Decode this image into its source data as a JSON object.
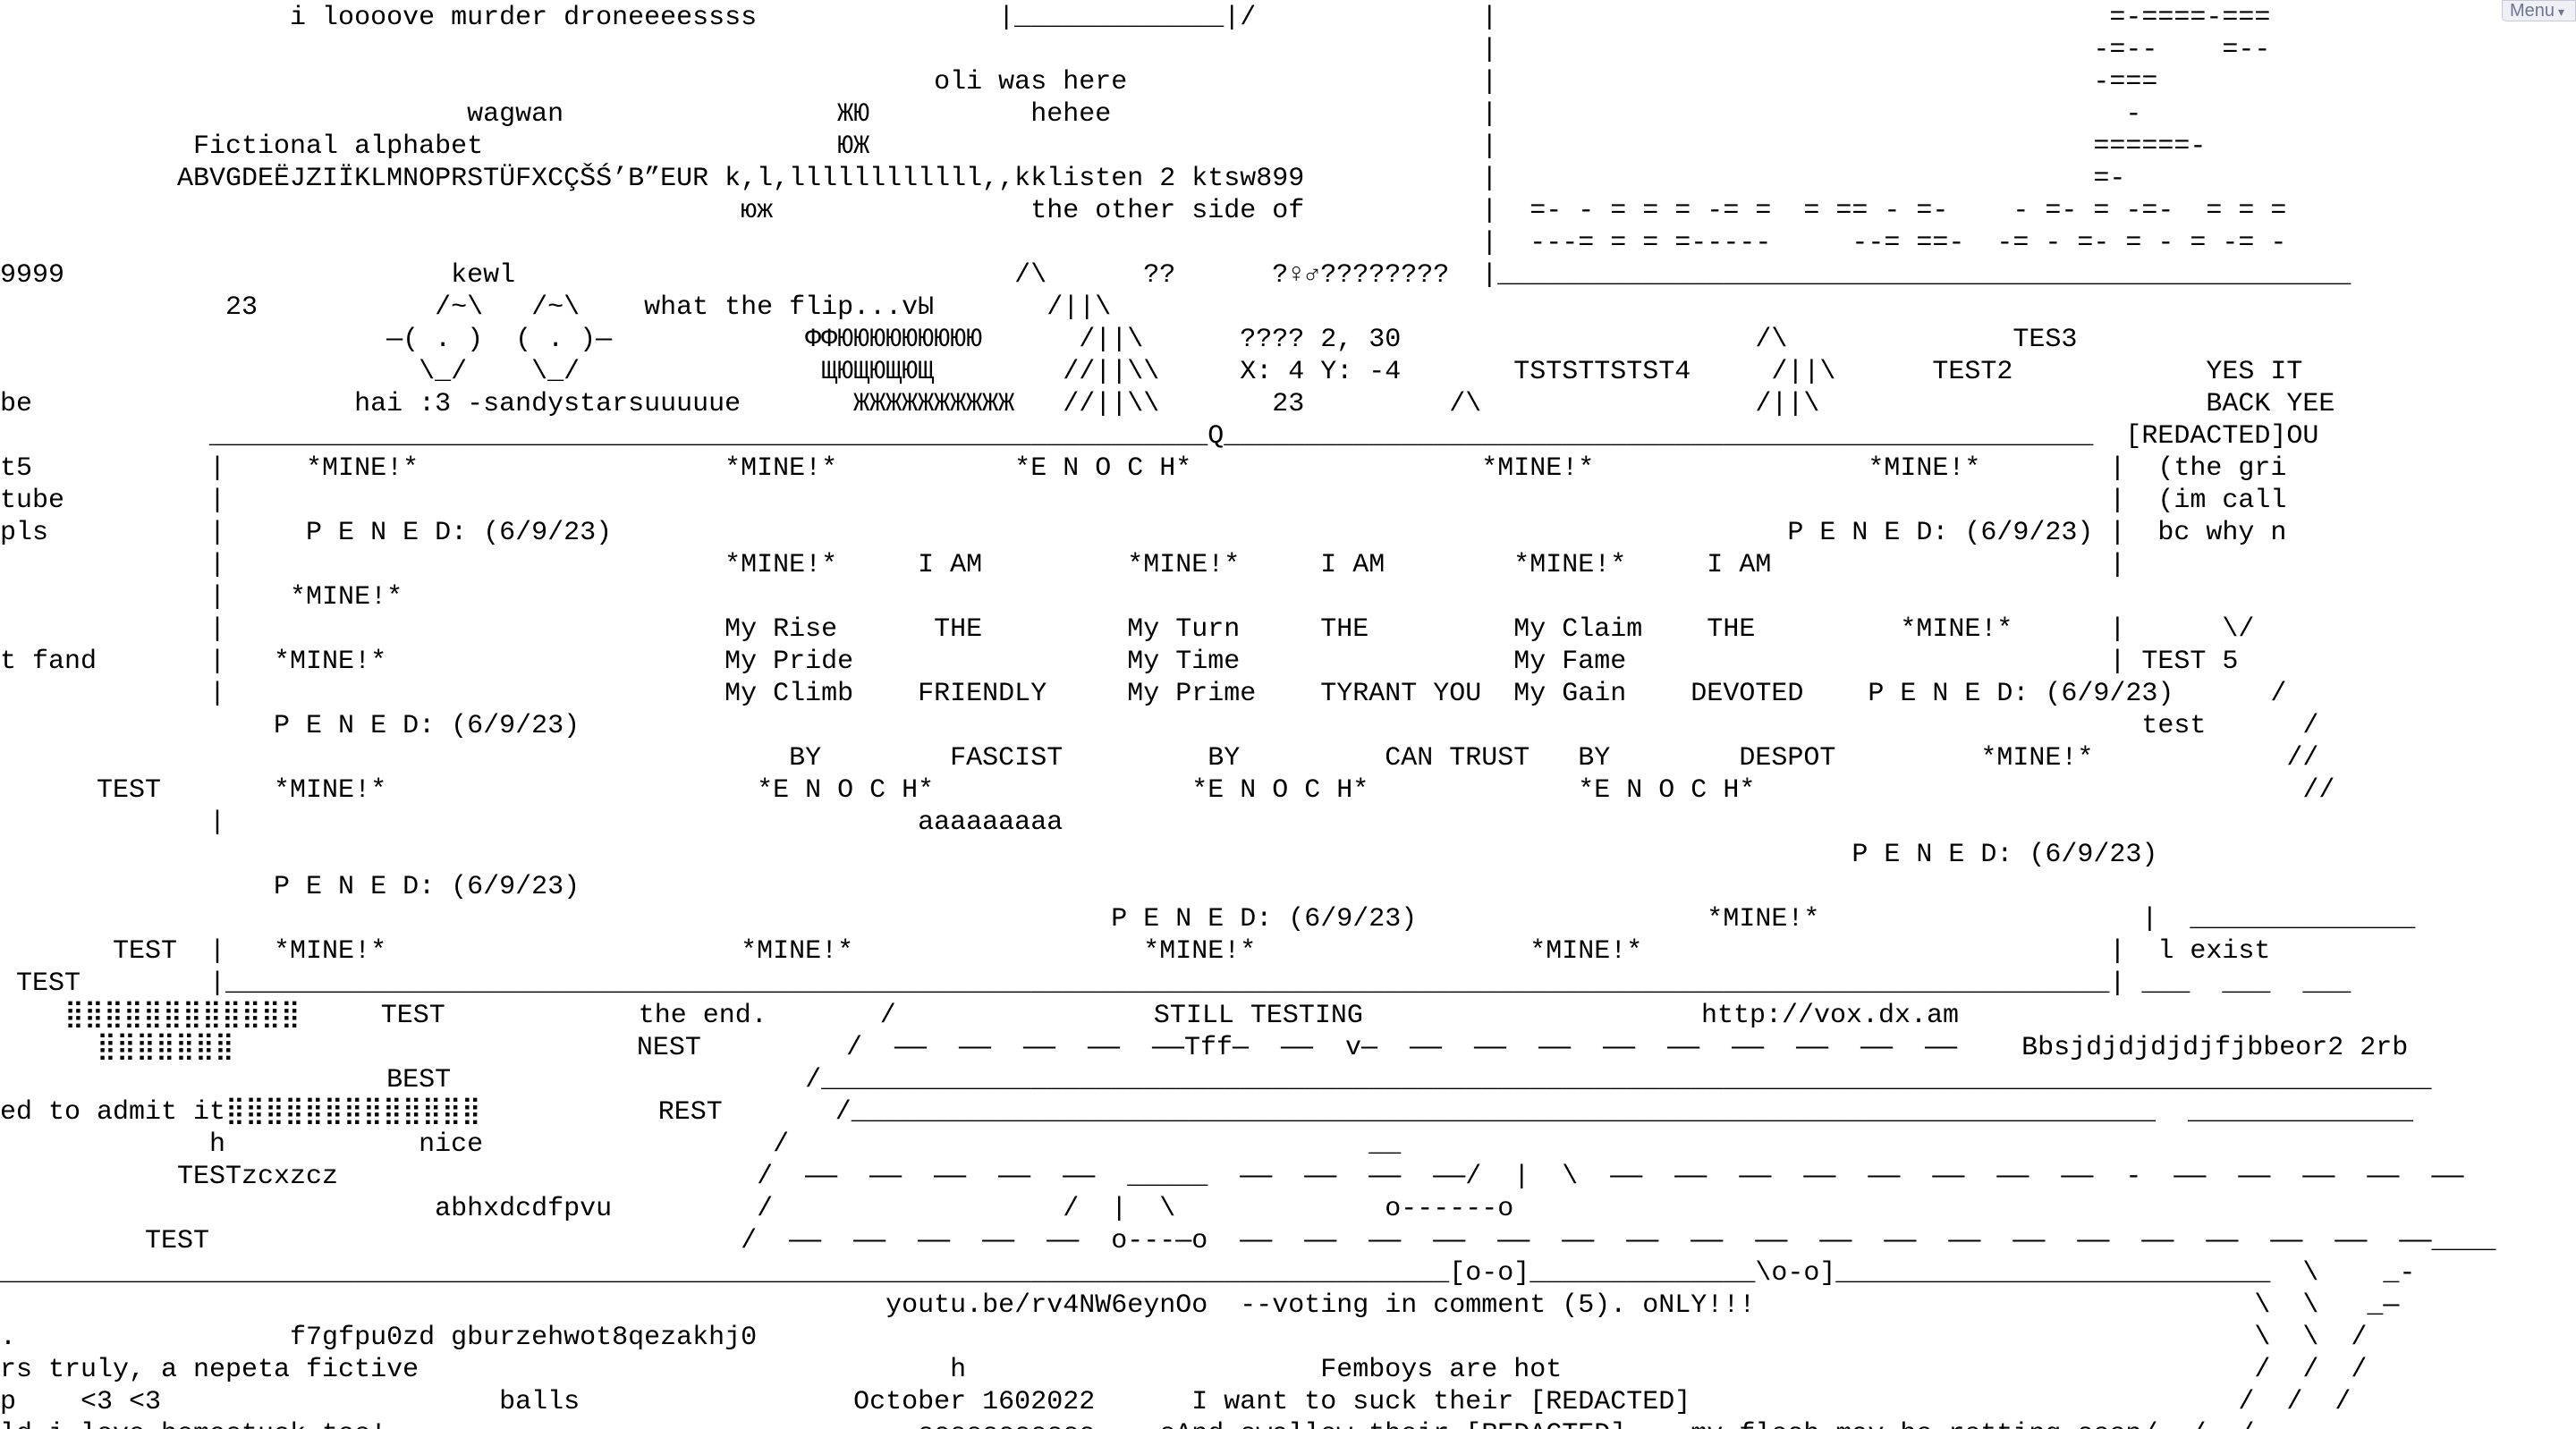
{
  "page": {
    "menu_label": "Menu",
    "menu_icon": "chevron-down-icon"
  },
  "canvas_text": [
    "                  i loooove murder droneeeessss               |_____________|/              |                                      =-====-===",
    "                                                                                            |                                     -=--    =--",
    "                                                          oli was here                      |                                     -===",
    "                             wagwan                 ЖЮ          hehee                       |                                       -",
    "            Fictional alphabet                      ЮЖ                                      |                                     ======-",
    "           ABVGDEËJZIЇKLMNOPRSTÜFXCÇŠŚ’B”EUR k,l,llllllllllll,,kklisten 2 ktsw899           |                                     =-",
    "                                              юж                the other side of           |  =- - = = = -= =  = == - =-    - =- = -=-  = = =",
    "                                                                                            |  ---= = = =-----     --= ==-  -= - =- = - = -= -",
    "9999                        kewl                               /\\      ??      ?♀♂????????  |_____________________________________________________",
    "              23           /~\\   /~\\    what the flip...vЫ       /||\\",
    "                        —( . )  ( . )—            ФФЮЮЮЮЮЮЮЮЮ      /||\\      ???? 2, 30                      /\\              TES3",
    "                          \\_/    \\_/               ЩЮЩЮЩЮЩ        //||\\\\     X: 4 Y: -4       TSTSTTSTST4     /||\\      TEST2            YES IT",
    "be                    hai :3 -sandystarsuuuuue       ЖЖЖЖЖЖЖЖЖЖ   //||\\\\       23         /\\                 /||\\                        BACK YEE",
    "             ______________________________________________________________Q______________________________________________________  [REDACTED]OU",
    "t5           |     *MINE!*                   *MINE!*           *E N O C H*                  *MINE!*                 *MINE!*        |  (the gri",
    "tube         |                                                                                                                     |  (im call",
    "pls          |     P E N E D: (6/9/23)                                                                         P E N E D: (6/9/23) |  bc why n",
    "             |                               *MINE!*     I AM         *MINE!*     I AM        *MINE!*     I AM                     |",
    "             |    *MINE!*",
    "             |                               My Rise      THE         My Turn     THE         My Claim    THE         *MINE!*      |      \\/",
    "t fand       |   *MINE!*                     My Pride                 My Time                 My Fame                              | TEST 5",
    "             |                               My Climb    FRIENDLY     My Prime    TYRANT YOU  My Gain    DEVOTED    P E N E D: (6/9/23)      /",
    "                 P E N E D: (6/9/23)                                                                                                 test      /",
    "                                                 BY        FASCIST         BY         CAN TRUST   BY        DESPOT         *MINE!*            //",
    "      TEST       *MINE!*                       *E N O C H*                *E N O C H*             *E N O C H*                                  //",
    "             |                                           aaaaaaaaa                                                                           ",
    "                                                                                                                   P E N E D: (6/9/23)",
    "                 P E N E D: (6/9/23)",
    "                                                                     P E N E D: (6/9/23)                  *MINE!*                    |  ______________",
    "       TEST  |   *MINE!*                      *MINE!*                  *MINE!*                 *MINE!*                             |  l exist",
    " TEST        |_____________________________________________________________________________________________________________________| ___  ___  ___",
    "    ⣿⣿⣿⣿⣿⣿⣿⣿⣿⣿⣿⣿     TEST            the end.       /                STILL TESTING                     http://vox.dx.am",
    "      ⣿⣿⣿⣿⣿⣿⣿                         NEST         /  ——  ——  ——  ——  ——Tff—  ——  v—  ——  ——  ——  ——  ——  ——  ——  ——  ——    Bbsjdjdjdjdjfjbbeor2 2rb",
    "                        BEST                      /____________________________________________________________________________________________________",
    "ed to admit it⣿⣿⣿⣿⣿⣿⣿⣿⣿⣿⣿⣿⣿           REST       /_________________________________________________________________________________  ______________",
    "             h            nice                  /                                    __",
    "           TESTzcxzcz                          /  ——  ——  ——  ——  ——  _____  ——  ——  ——  ——/  |  \\  ——  ——  ——  ——  ——  ——  ——  ——  -  ——  ——  ——  ——  ——",
    "                           abhxdcdfpvu         /                  /  |  \\             o------o",
    "         TEST                                 /  ——  ——  ——  ——  ——  o---—o  ——  ——  ——  ——  ——  ——  ——  ——  ——  ——  ——  ——  ——  ——  ——  ——  ——  ——  ——____",
    "__________________________________________________________________________________________[o-o]______________\\o-o]___________________________  \\    _-",
    "                                                       youtu.be/rv4NW6eynOo  --voting in comment (5). oNLY!!!                               \\  \\   _—",
    ".                 f7gfpu0zd gburzehwot8qezakhj0                                                                                             \\  \\  /",
    "rs truly, a nepeta fictive                                 h                      Femboys are hot                                           /  /  /",
    "p    <3 <3                     balls                 October 1602022      I want to suck their [REDACTED]                                  /  /  /",
    "ld i love homestuck too!                                 sssssssssss    sAnd swallow their [REDACTED]    my flesh may be rotting soon/  /  /"
  ]
}
